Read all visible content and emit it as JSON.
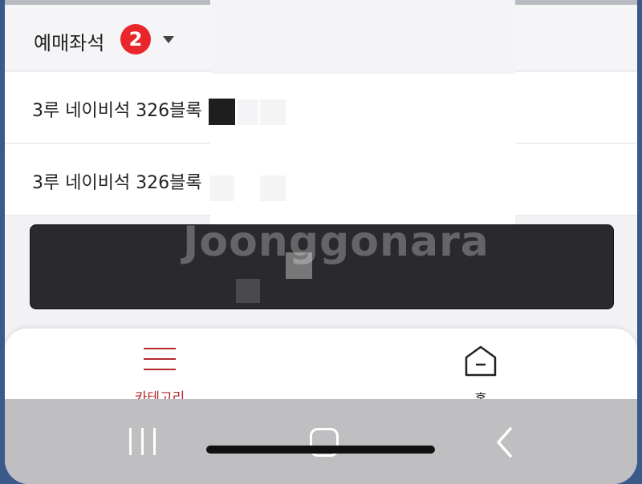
{
  "header": {
    "title": "예매좌석",
    "count": "2"
  },
  "seats": [
    {
      "label": "3루 네이비석 326블록"
    },
    {
      "label": "3루 네이비석 326블록"
    }
  ],
  "watermark": "Joonggonara",
  "bottom_nav": {
    "items": [
      {
        "label": "카테고리",
        "icon": "hamburger-menu-icon",
        "active": true
      },
      {
        "label": "홈",
        "icon": "home-icon",
        "active": false
      }
    ]
  },
  "system_nav": {
    "icons": [
      "recent-apps-icon",
      "home-button-icon",
      "back-icon"
    ]
  },
  "colors": {
    "accent": "#b5282e",
    "badge": "#e8262c",
    "panel": "#2a2a2e"
  }
}
